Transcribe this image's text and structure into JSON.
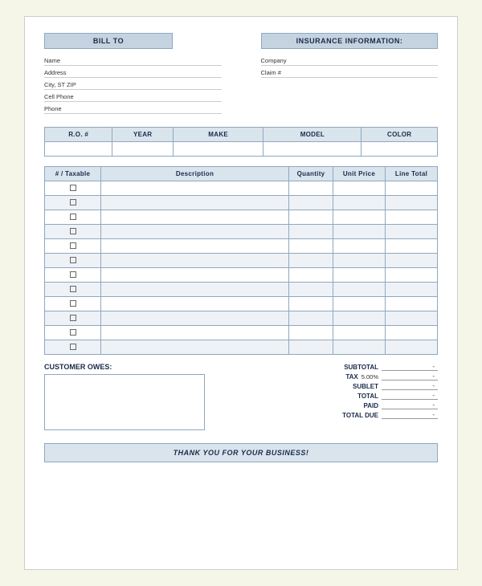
{
  "invoice": {
    "bill_to_label": "BILL TO",
    "insurance_label": "INSURANCE INFORMATION:",
    "bill_to_fields": [
      {
        "label": "Name",
        "value": ""
      },
      {
        "label": "Address",
        "value": ""
      },
      {
        "label": "City, ST ZIP",
        "value": ""
      },
      {
        "label": "Cell Phone",
        "value": ""
      },
      {
        "label": "Phone",
        "value": ""
      }
    ],
    "insurance_fields": [
      {
        "label": "Company",
        "value": ""
      },
      {
        "label": "Claim #",
        "value": ""
      }
    ],
    "vehicle_headers": [
      "R.O. #",
      "YEAR",
      "MAKE",
      "MODEL",
      "COLOR"
    ],
    "items_headers": [
      "# / Taxable",
      "Description",
      "Quantity",
      "Unit Price",
      "Line Total"
    ],
    "num_rows": 12,
    "totals": {
      "subtotal_label": "SUBTOTAL",
      "subtotal_value": "-",
      "tax_label": "TAX",
      "tax_rate": "5.00%",
      "tax_value": "-",
      "sublet_label": "SUBLET",
      "sublet_value": "-",
      "total_label": "TOTAL",
      "total_value": "-",
      "paid_label": "PAID",
      "paid_value": "-",
      "total_due_label": "TOTAL DUE",
      "total_due_value": "-"
    },
    "customer_owes_label": "CUSTOMER OWES:",
    "footer_text": "THANK YOU FOR YOUR BUSINESS!"
  }
}
